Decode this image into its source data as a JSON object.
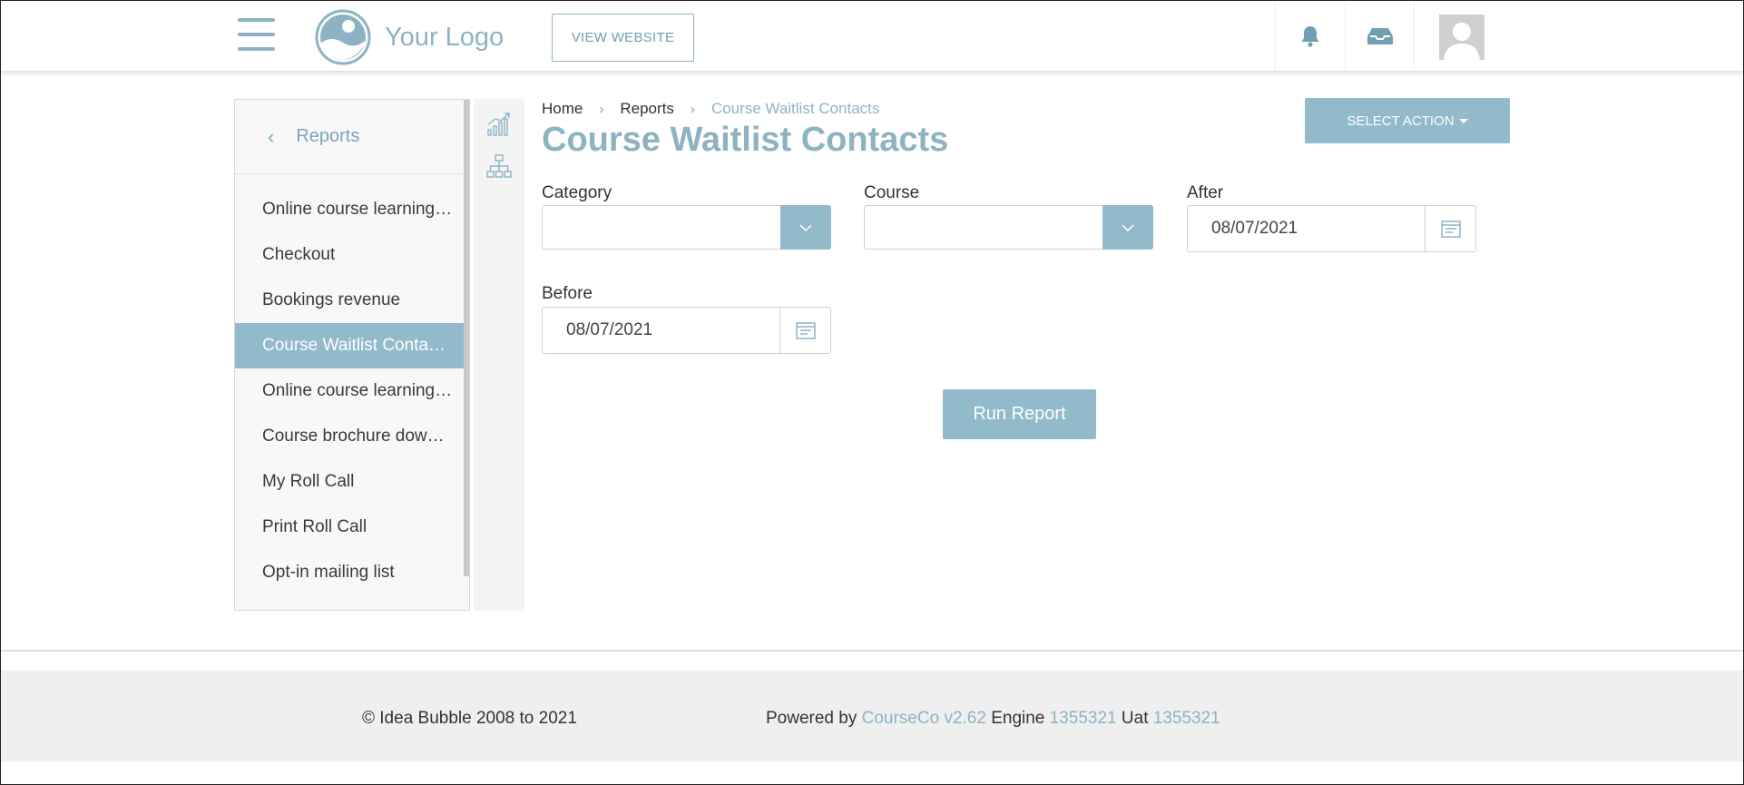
{
  "header": {
    "logo_text": "Your Logo",
    "view_website_label": "VIEW WEBSITE",
    "icons": [
      "hamburger-menu-icon",
      "bell-icon",
      "inbox-icon",
      "avatar"
    ]
  },
  "sidebar": {
    "title": "Reports",
    "items": [
      {
        "label": "Online course learning…"
      },
      {
        "label": "Checkout"
      },
      {
        "label": "Bookings revenue"
      },
      {
        "label": "Course Waitlist Conta…",
        "active": true
      },
      {
        "label": "Online course learning…"
      },
      {
        "label": "Course brochure dow…"
      },
      {
        "label": "My Roll Call"
      },
      {
        "label": "Print Roll Call"
      },
      {
        "label": "Opt-in mailing list"
      }
    ]
  },
  "breadcrumb": {
    "home": "Home",
    "reports": "Reports",
    "current": "Course Waitlist Contacts",
    "separator": "›"
  },
  "page": {
    "title": "Course Waitlist Contacts",
    "select_action_label": "SELECT ACTION"
  },
  "form": {
    "category_label": "Category",
    "category_value": "",
    "course_label": "Course",
    "course_value": "",
    "after_label": "After",
    "after_value": "08/07/2021",
    "before_label": "Before",
    "before_value": "08/07/2021",
    "run_label": "Run Report"
  },
  "footer": {
    "copyright": "© Idea Bubble 2008 to 2021",
    "powered_by": "Powered by",
    "product": "CourseCo v2.62",
    "engine_label": "Engine",
    "engine_value": "1355321",
    "uat_label": "Uat",
    "uat_value": "1355321"
  },
  "colors": {
    "accent": "#92bacb",
    "accent_text": "#8db3c3"
  }
}
